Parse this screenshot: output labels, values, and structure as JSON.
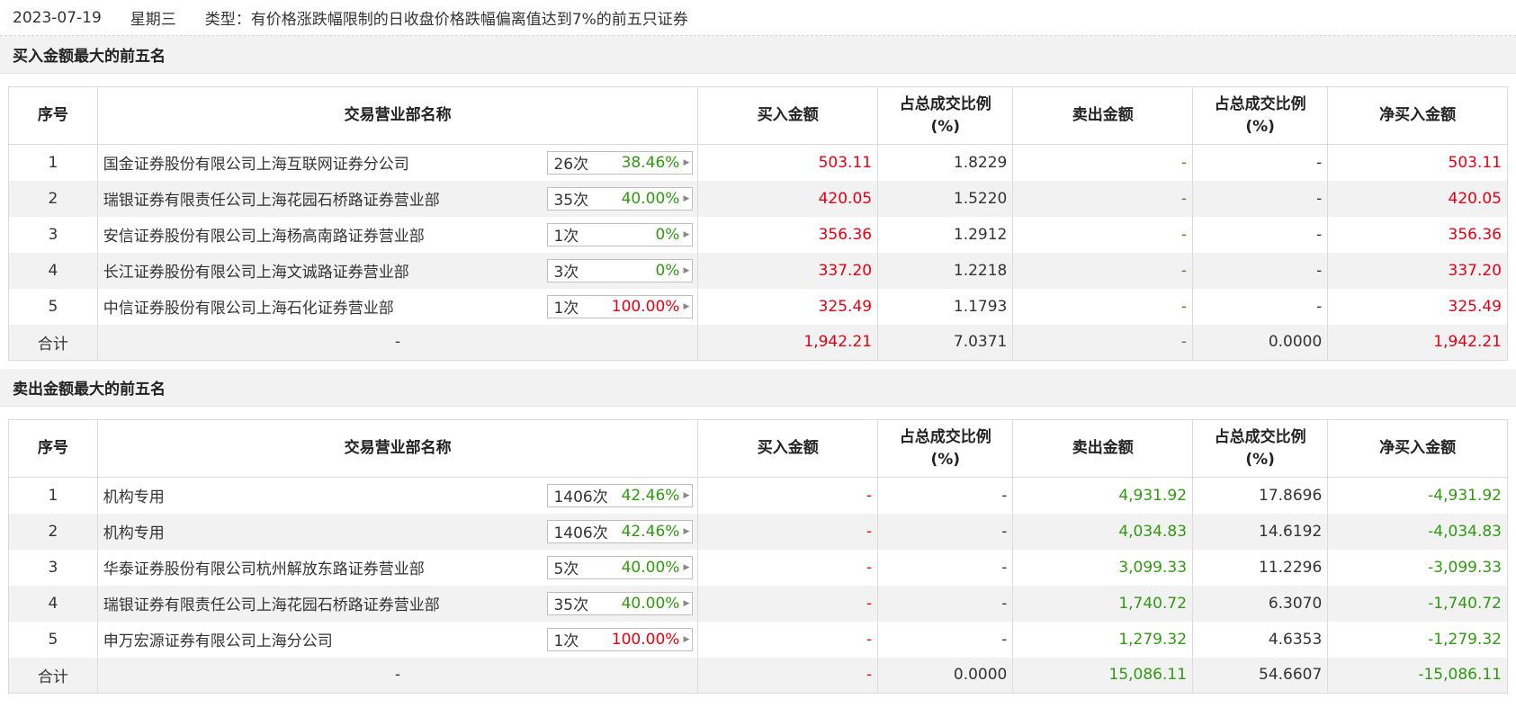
{
  "header": {
    "date": "2023-07-19",
    "weekday": "星期三",
    "type_text": "类型：有价格涨跌幅限制的日收盘价格跌幅偏离值达到7%的前五只证券"
  },
  "buy_section": {
    "title": "买入金额最大的前五名",
    "columns": [
      "序号",
      "交易营业部名称",
      "买入金额",
      "占总成交比例",
      "(%)",
      "卖出金额",
      "占总成交比例",
      "(%)",
      "净买入金额"
    ],
    "rows": [
      {
        "idx": "1",
        "name": "国金证券股份有限公司上海互联网证券分公司",
        "count": "26次",
        "pct": "38.46%",
        "pct_color": "green",
        "buy": "503.11",
        "buy_ratio": "1.8229",
        "sell": "-",
        "sell_ratio": "-",
        "net": "503.11"
      },
      {
        "idx": "2",
        "name": "瑞银证券有限责任公司上海花园石桥路证券营业部",
        "count": "35次",
        "pct": "40.00%",
        "pct_color": "green",
        "buy": "420.05",
        "buy_ratio": "1.5220",
        "sell": "-",
        "sell_ratio": "-",
        "net": "420.05"
      },
      {
        "idx": "3",
        "name": "安信证券股份有限公司上海杨高南路证券营业部",
        "count": "1次",
        "pct": "0%",
        "pct_color": "green",
        "buy": "356.36",
        "buy_ratio": "1.2912",
        "sell": "-",
        "sell_ratio": "-",
        "net": "356.36"
      },
      {
        "idx": "4",
        "name": "长江证券股份有限公司上海文诚路证券营业部",
        "count": "3次",
        "pct": "0%",
        "pct_color": "green",
        "buy": "337.20",
        "buy_ratio": "1.2218",
        "sell": "-",
        "sell_ratio": "-",
        "net": "337.20"
      },
      {
        "idx": "5",
        "name": "中信证券股份有限公司上海石化证券营业部",
        "count": "1次",
        "pct": "100.00%",
        "pct_color": "red",
        "buy": "325.49",
        "buy_ratio": "1.1793",
        "sell": "-",
        "sell_ratio": "-",
        "net": "325.49"
      }
    ],
    "total": {
      "label": "合计",
      "name": "-",
      "buy": "1,942.21",
      "buy_ratio": "7.0371",
      "sell": "-",
      "sell_ratio": "0.0000",
      "net": "1,942.21"
    }
  },
  "sell_section": {
    "title": "卖出金额最大的前五名",
    "columns": [
      "序号",
      "交易营业部名称",
      "买入金额",
      "占总成交比例",
      "(%)",
      "卖出金额",
      "占总成交比例",
      "(%)",
      "净买入金额"
    ],
    "rows": [
      {
        "idx": "1",
        "name": "机构专用",
        "count": "1406次",
        "pct": "42.46%",
        "pct_color": "green",
        "buy": "-",
        "buy_ratio": "-",
        "sell": "4,931.92",
        "sell_ratio": "17.8696",
        "net": "-4,931.92"
      },
      {
        "idx": "2",
        "name": "机构专用",
        "count": "1406次",
        "pct": "42.46%",
        "pct_color": "green",
        "buy": "-",
        "buy_ratio": "-",
        "sell": "4,034.83",
        "sell_ratio": "14.6192",
        "net": "-4,034.83"
      },
      {
        "idx": "3",
        "name": "华泰证券股份有限公司杭州解放东路证券营业部",
        "count": "5次",
        "pct": "40.00%",
        "pct_color": "green",
        "buy": "-",
        "buy_ratio": "-",
        "sell": "3,099.33",
        "sell_ratio": "11.2296",
        "net": "-3,099.33"
      },
      {
        "idx": "4",
        "name": "瑞银证券有限责任公司上海花园石桥路证券营业部",
        "count": "35次",
        "pct": "40.00%",
        "pct_color": "green",
        "buy": "-",
        "buy_ratio": "-",
        "sell": "1,740.72",
        "sell_ratio": "6.3070",
        "net": "-1,740.72"
      },
      {
        "idx": "5",
        "name": "申万宏源证券有限公司上海分公司",
        "count": "1次",
        "pct": "100.00%",
        "pct_color": "red",
        "buy": "-",
        "buy_ratio": "-",
        "sell": "1,279.32",
        "sell_ratio": "4.6353",
        "net": "-1,279.32"
      }
    ],
    "total": {
      "label": "合计",
      "name": "-",
      "buy": "-",
      "buy_ratio": "0.0000",
      "sell": "15,086.11",
      "sell_ratio": "54.6607",
      "net": "-15,086.11"
    }
  },
  "colors": {
    "up": "#e60012",
    "down": "#2f9a0f",
    "row_alt": "#f2f2f2"
  },
  "icons": {
    "badge_arrow": "caret-right-icon"
  }
}
